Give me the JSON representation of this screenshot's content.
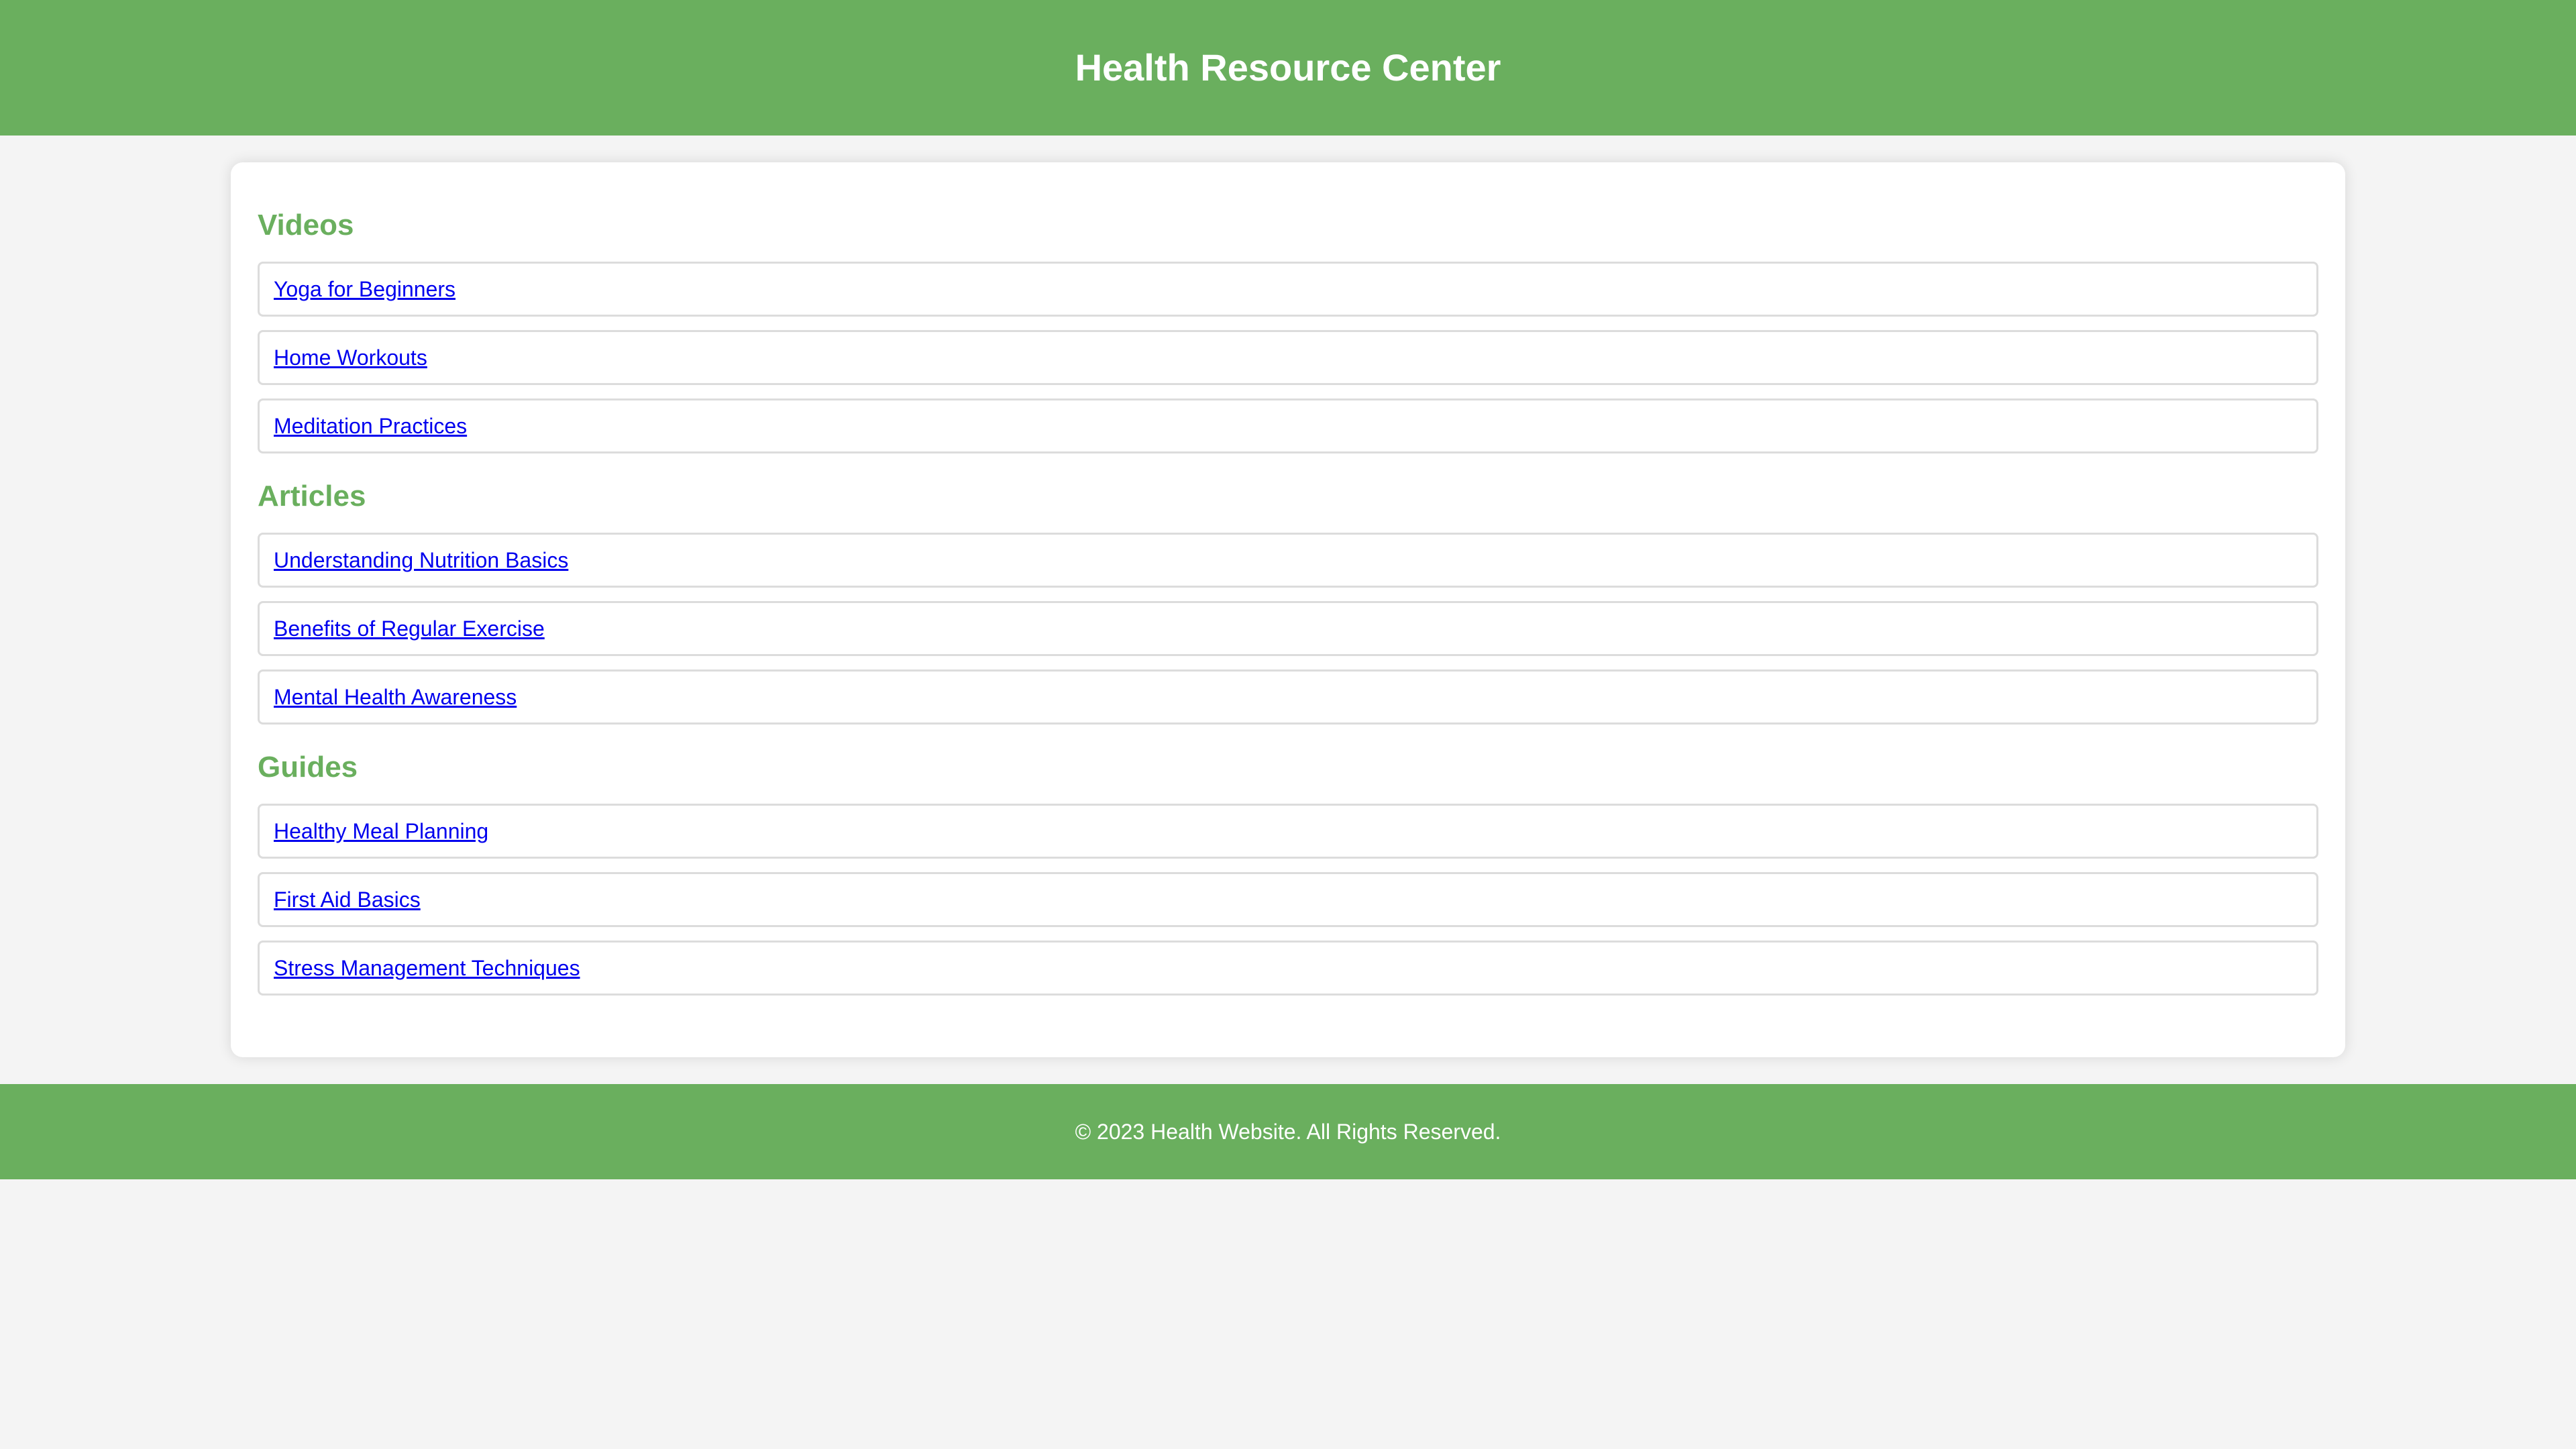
{
  "header": {
    "title": "Health Resource Center"
  },
  "sections": [
    {
      "heading": "Videos",
      "items": [
        {
          "label": "Yoga for Beginners"
        },
        {
          "label": "Home Workouts"
        },
        {
          "label": "Meditation Practices"
        }
      ]
    },
    {
      "heading": "Articles",
      "items": [
        {
          "label": "Understanding Nutrition Basics"
        },
        {
          "label": "Benefits of Regular Exercise"
        },
        {
          "label": "Mental Health Awareness"
        }
      ]
    },
    {
      "heading": "Guides",
      "items": [
        {
          "label": "Healthy Meal Planning"
        },
        {
          "label": "First Aid Basics"
        },
        {
          "label": "Stress Management Techniques"
        }
      ]
    }
  ],
  "footer": {
    "text": "© 2023 Health Website. All Rights Reserved."
  },
  "colors": {
    "brand_green": "#6aaf5e",
    "link_blue": "#0000ee",
    "page_background": "#f4f4f4"
  }
}
